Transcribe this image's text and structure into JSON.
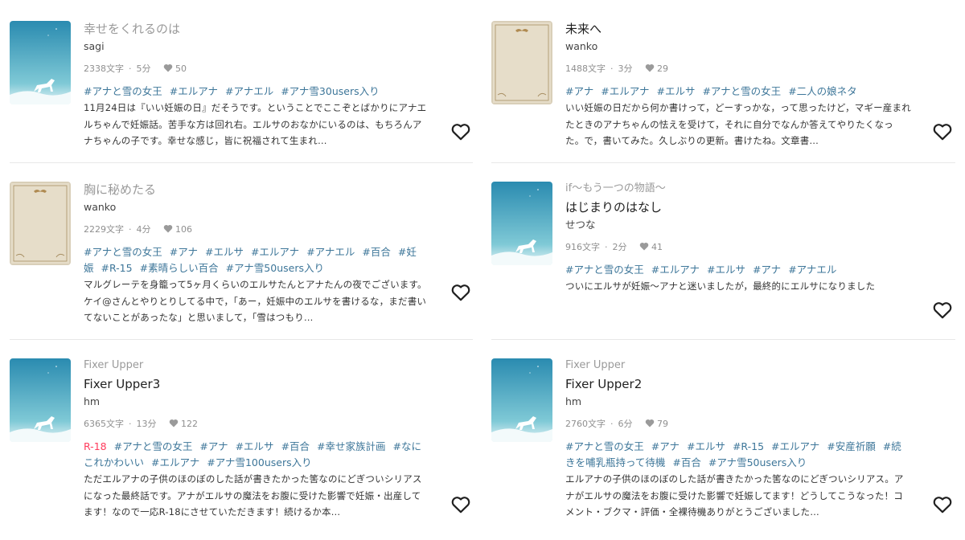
{
  "colors": {
    "tag": "#3d7699",
    "r18": "#ff3b5c",
    "muted": "#9a9a9a"
  },
  "cards": [
    {
      "cover": "sky-horse",
      "series": "",
      "title": "幸せをくれるのは",
      "author": "sagi",
      "chars": "2338文字",
      "minutes": "5分",
      "bookmarks": "50",
      "tags": [
        "#アナと雪の女王",
        "#エルアナ",
        "#アナエル",
        "#アナ雪30users入り"
      ],
      "desc": "11月24日は『いい妊娠の日』だそうです。ということでここぞとばかりにアナエルちゃんで妊娠話。苦手な方は回れ右。エルサのおなかにいるのは、もちろんアナちゃんの子です。幸せな感じ，皆に祝福されて生まれ…"
    },
    {
      "cover": "parchment",
      "series": "",
      "title": "未来へ",
      "author": "wanko",
      "chars": "1488文字",
      "minutes": "3分",
      "bookmarks": "29",
      "tags": [
        "#アナ",
        "#エルアナ",
        "#エルサ",
        "#アナと雪の女王",
        "#二人の娘ネタ"
      ],
      "desc": "いい妊娠の日だから何か書けって，どーすっかな，って思ったけど，マギー産まれたときのアナちゃんの怯えを受けて，それに自分でなんか答えてやりたくなった。で，書いてみた。久しぶりの更新。書けたね。文章書…"
    },
    {
      "cover": "parchment",
      "series": "",
      "title": "胸に秘めたる",
      "author": "wanko",
      "chars": "2229文字",
      "minutes": "4分",
      "bookmarks": "106",
      "tags": [
        "#アナと雪の女王",
        "#アナ",
        "#エルサ",
        "#エルアナ",
        "#アナエル",
        "#百合",
        "#妊娠",
        "#R-15",
        "#素晴らしい百合",
        "#アナ雪50users入り"
      ],
      "desc": "マルグレーテを身籠って5ヶ月くらいのエルサたんとアナたんの夜でございます。ケイ@さんとやりとりしてる中で，「あー，妊娠中のエルサを書けるな，まだ書いてないことがあったな」と思いまして，「雪はつもり…"
    },
    {
      "cover": "sky-horse",
      "series": "if～もう一つの物語～",
      "title": "はじまりのはなし",
      "author": "せつな",
      "chars": "916文字",
      "minutes": "2分",
      "bookmarks": "41",
      "tags": [
        "#アナと雪の女王",
        "#エルアナ",
        "#エルサ",
        "#アナ",
        "#アナエル"
      ],
      "desc": "ついにエルサが妊娠～アナと迷いましたが，最終的にエルサになりました"
    },
    {
      "cover": "sky-horse",
      "series": "Fixer Upper",
      "title": "Fixer Upper3",
      "author": "hm",
      "chars": "6365文字",
      "minutes": "13分",
      "bookmarks": "122",
      "r18": "R-18",
      "tags": [
        "#アナと雪の女王",
        "#アナ",
        "#エルサ",
        "#百合",
        "#幸せ家族計画",
        "#なにこれかわいい",
        "#エルアナ",
        "#アナ雪100users入り"
      ],
      "desc": "ただエルアナの子供のほのぼのした話が書きたかった筈なのにどぎついシリアスになった最終話です。アナがエルサの魔法をお腹に受けた影響で妊娠・出産してます！なので一応R-18にさせていただきます！続けるか本…"
    },
    {
      "cover": "sky-horse",
      "series": "Fixer Upper",
      "title": "Fixer Upper2",
      "author": "hm",
      "chars": "2760文字",
      "minutes": "6分",
      "bookmarks": "79",
      "tags": [
        "#アナと雪の女王",
        "#アナ",
        "#エルサ",
        "#R-15",
        "#エルアナ",
        "#安産祈願",
        "#続きを哺乳瓶持って待機",
        "#百合",
        "#アナ雪50users入り"
      ],
      "desc": "エルアナの子供のほのぼのした話が書きたかった筈なのにどぎついシリアス。アナがエルサの魔法をお腹に受けた影響で妊娠してます！どうしてこうなった！コメント・ブクマ・評価・全裸待機ありがとうございました…"
    }
  ]
}
